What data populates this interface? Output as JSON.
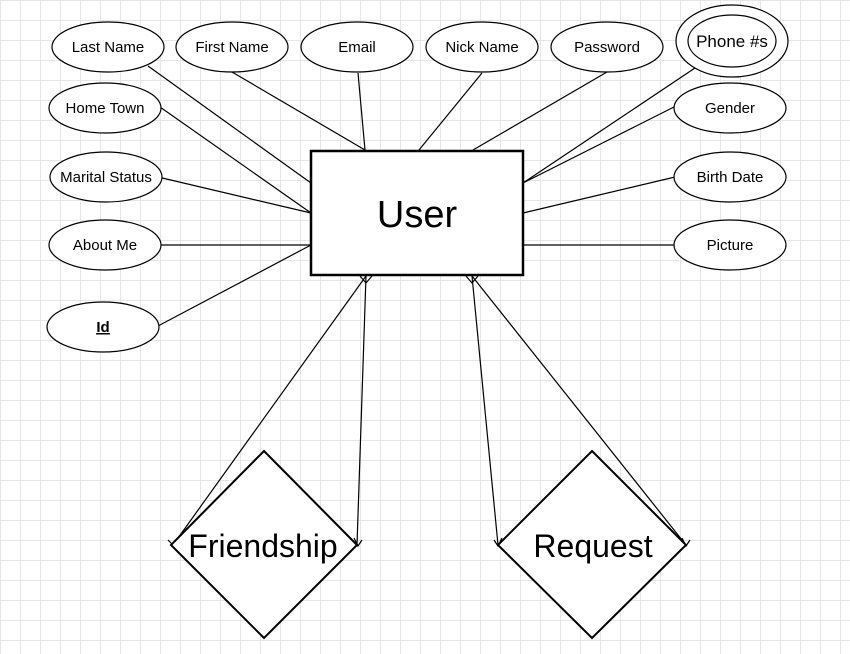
{
  "entity": {
    "name": "User"
  },
  "attributes": {
    "last_name": "Last Name",
    "first_name": "First Name",
    "email": "Email",
    "nick_name": "Nick Name",
    "password": "Password",
    "phone": "Phone #s",
    "home_town": "Home Town",
    "gender": "Gender",
    "marital_status": "Marital Status",
    "birth_date": "Birth Date",
    "about_me": "About Me",
    "picture": "Picture",
    "id": "Id"
  },
  "relationships": {
    "friendship": "Friendship",
    "request": "Request"
  }
}
